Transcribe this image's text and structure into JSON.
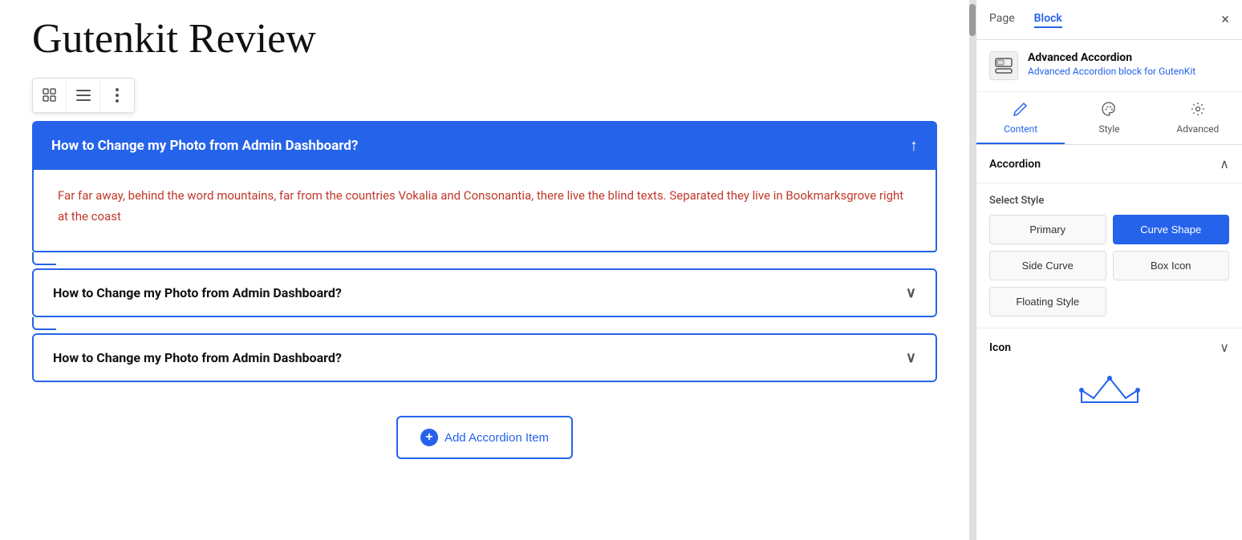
{
  "page": {
    "title": "Gutenkit Review"
  },
  "toolbar": {
    "btn1_icon": "⊞",
    "btn2_icon": "≡",
    "btn3_icon": "⋮"
  },
  "accordion": {
    "open_item": {
      "title": "How to Change my Photo from Admin Dashboard?",
      "content": "Far far away, behind the word mountains, far from the countries Vokalia and Consonantia, there live the blind texts. Separated they live in Bookmarksgrove right at the coast"
    },
    "items": [
      {
        "title": "How to Change my Photo from Admin Dashboard?"
      },
      {
        "title": "How to Change my Photo from Admin Dashboard?"
      }
    ],
    "add_btn_label": "Add Accordion Item"
  },
  "right_panel": {
    "tabs": [
      "Page",
      "Block"
    ],
    "active_tab": "Block",
    "close_label": "×",
    "block_info": {
      "name": "Advanced Accordion",
      "description": "Advanced Accordion block for GutenKit"
    },
    "edit_tabs": [
      {
        "label": "Content",
        "icon": "✏️",
        "active": true
      },
      {
        "label": "Style",
        "icon": "🎨",
        "active": false
      },
      {
        "label": "Advanced",
        "icon": "⚙️",
        "active": false
      }
    ],
    "accordion_section": {
      "title": "Accordion",
      "expanded": true
    },
    "select_style": {
      "label": "Select Style",
      "options": [
        {
          "label": "Primary",
          "value": "primary",
          "active": false
        },
        {
          "label": "Curve Shape",
          "value": "curve-shape",
          "active": true
        },
        {
          "label": "Side Curve",
          "value": "side-curve",
          "active": false
        },
        {
          "label": "Box Icon",
          "value": "box-icon",
          "active": false
        },
        {
          "label": "Floating Style",
          "value": "floating-style",
          "active": false
        }
      ]
    },
    "icon_section": {
      "title": "Icon",
      "expanded": true
    }
  }
}
